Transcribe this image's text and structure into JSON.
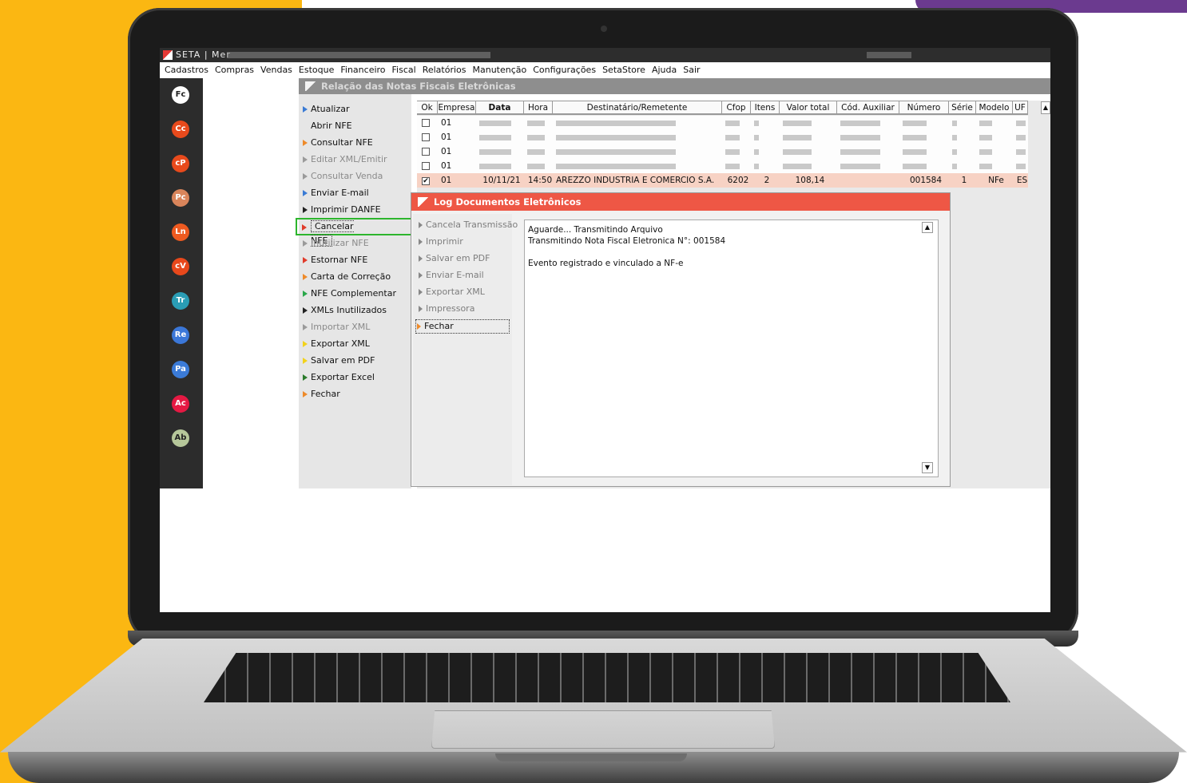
{
  "app": {
    "title": "SETA | Mer"
  },
  "menu": [
    "Cadastros",
    "Compras",
    "Vendas",
    "Estoque",
    "Financeiro",
    "Fiscal",
    "Relatórios",
    "Manutenção",
    "Configurações",
    "SetaStore",
    "Ajuda",
    "Sair"
  ],
  "rail": [
    {
      "label": "Fc",
      "color": "#ffffff",
      "text": "#222222"
    },
    {
      "label": "Cc",
      "color": "#e84a1c",
      "text": "#ffffff"
    },
    {
      "label": "cP",
      "color": "#e84a1c",
      "text": "#ffffff"
    },
    {
      "label": "Pc",
      "color": "#d9855b",
      "text": "#ffffff"
    },
    {
      "label": "Ln",
      "color": "#ee5a20",
      "text": "#ffffff"
    },
    {
      "label": "cV",
      "color": "#e8481b",
      "text": "#ffffff"
    },
    {
      "label": "Tr",
      "color": "#2a9db5",
      "text": "#ffffff"
    },
    {
      "label": "Re",
      "color": "#3b77d8",
      "text": "#ffffff"
    },
    {
      "label": "Pa",
      "color": "#3b7bd8",
      "text": "#ffffff"
    },
    {
      "label": "Ac",
      "color": "#e51943",
      "text": "#ffffff"
    },
    {
      "label": "Ab",
      "color": "#b6c79a",
      "text": "#222222"
    }
  ],
  "panel_title": "Relação das Notas Fiscais Eletrônicas",
  "side_actions": [
    {
      "label": "Atualizar",
      "arrow": "#3a7bd5",
      "disabled": false
    },
    {
      "label": "Abrir NFE",
      "arrow": "#e6e6e6",
      "disabled": false
    },
    {
      "label": "Consultar NFE",
      "arrow": "#ee8a2a",
      "disabled": false
    },
    {
      "label": "Editar XML/Emitir",
      "arrow": "#9a9a9a",
      "disabled": true
    },
    {
      "label": "Consultar Venda",
      "arrow": "#9a9a9a",
      "disabled": true
    },
    {
      "label": "Enviar E-mail",
      "arrow": "#3a7bd5",
      "disabled": false
    },
    {
      "label": "Imprimir DANFE",
      "arrow": "#222222",
      "disabled": false
    },
    {
      "label": "Cancelar NFE",
      "arrow": "#e03b2b",
      "disabled": false
    },
    {
      "label": "Inutilizar NFE",
      "arrow": "#9a9a9a",
      "disabled": true
    },
    {
      "label": "Estornar NFE",
      "arrow": "#e03b2b",
      "disabled": false
    },
    {
      "label": "Carta de Correção",
      "arrow": "#ee8a2a",
      "disabled": false
    },
    {
      "label": "NFE Complementar",
      "arrow": "#2aa84a",
      "disabled": false
    },
    {
      "label": "XMLs Inutilizados",
      "arrow": "#222222",
      "disabled": false
    },
    {
      "label": "Importar XML",
      "arrow": "#9a9a9a",
      "disabled": true
    },
    {
      "label": "Exportar XML",
      "arrow": "#f2d21b",
      "disabled": false
    },
    {
      "label": "Salvar em PDF",
      "arrow": "#f2d21b",
      "disabled": false
    },
    {
      "label": "Exportar Excel",
      "arrow": "#2a7a2a",
      "disabled": false
    },
    {
      "label": "Fechar",
      "arrow": "#ee8a2a",
      "disabled": false
    }
  ],
  "table": {
    "headers": [
      "Ok",
      "Empresa",
      "Data",
      "Hora",
      "Destinatário/Remetente",
      "Cfop",
      "Itens",
      "Valor total",
      "Cód. Auxiliar",
      "Número",
      "Série",
      "Modelo",
      "UF"
    ],
    "rows": [
      {
        "ok": false,
        "empresa": "01"
      },
      {
        "ok": false,
        "empresa": "01"
      },
      {
        "ok": false,
        "empresa": "01"
      },
      {
        "ok": false,
        "empresa": "01"
      },
      {
        "ok": true,
        "empresa": "01",
        "data": "10/11/21",
        "hora": "14:50",
        "destinatario": "AREZZO INDUSTRIA E COMERCIO S.A.",
        "cfop": "6202",
        "itens": "2",
        "valor": "108,14",
        "numero": "001584",
        "serie": "1",
        "modelo": "NFe",
        "uf": "ES"
      }
    ]
  },
  "dialog": {
    "title": "Log Documentos Eletrônicos",
    "actions": [
      "Cancela Transmissão",
      "Imprimir",
      "Salvar em PDF",
      "Enviar E-mail",
      "Exportar XML",
      "Impressora",
      "Fechar"
    ],
    "log": [
      "Aguarde... Transmitindo Arquivo",
      "Transmitindo Nota Fiscal Eletronica N°: 001584",
      "",
      "Evento registrado e vinculado a NF-e"
    ]
  },
  "colors": {
    "accent_red": "#ee5745",
    "selected_row": "#f7d2c4",
    "focus_green": "#2db52d",
    "background_yellow": "#FBB712"
  }
}
